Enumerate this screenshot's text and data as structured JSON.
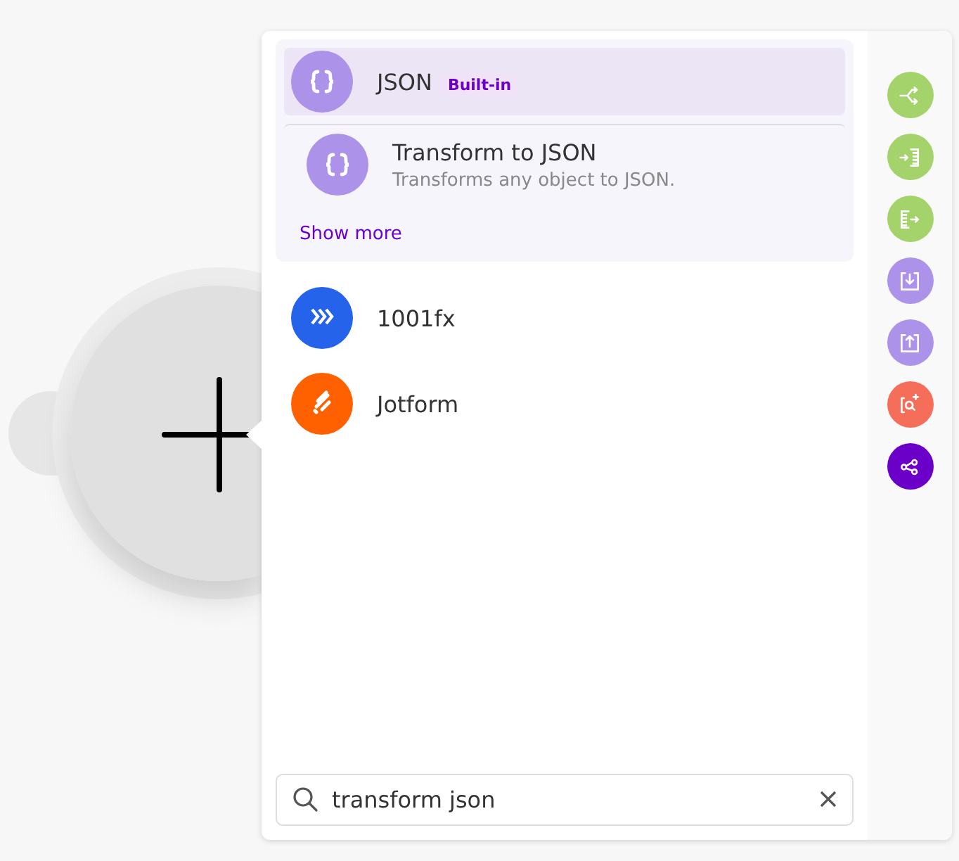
{
  "group": {
    "items": [
      {
        "title": "JSON",
        "badge": "Built-in",
        "selected": true,
        "kind": "app"
      },
      {
        "title": "Transform to JSON",
        "description": "Transforms any object to JSON.",
        "selected": false,
        "kind": "module"
      }
    ],
    "show_more": "Show more"
  },
  "apps": [
    {
      "title": "1001fx",
      "color": "#2563eb",
      "kind": "chevrons"
    },
    {
      "title": "Jotform",
      "color": "#ff6100",
      "kind": "pencil"
    }
  ],
  "search": {
    "value": "transform json"
  },
  "tools": [
    {
      "kind": "router",
      "color": "#a3d36a"
    },
    {
      "kind": "iterator",
      "color": "#a3d36a"
    },
    {
      "kind": "aggregator",
      "color": "#a3d36a"
    },
    {
      "kind": "import",
      "color": "#ad92ea"
    },
    {
      "kind": "export",
      "color": "#ad92ea"
    },
    {
      "kind": "search",
      "color": "#f56e5a"
    },
    {
      "kind": "share",
      "color": "#6b00c9"
    }
  ]
}
